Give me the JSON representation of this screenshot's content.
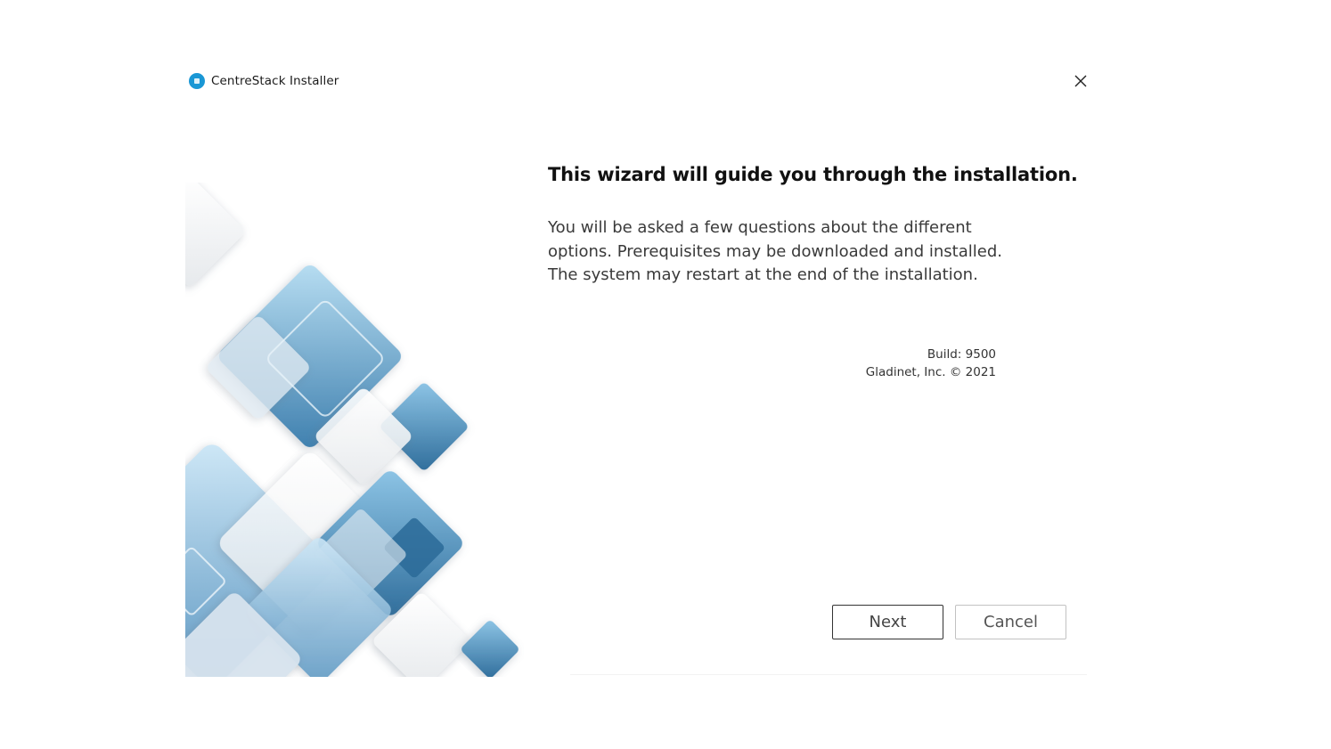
{
  "window": {
    "title": "CentreStack Installer",
    "app_icon": "centrestack-logo-icon",
    "close_icon": "close-icon",
    "accent_color": "#1a97d5"
  },
  "content": {
    "heading": "This wizard will guide you through the installation.",
    "description_lines": [
      "You will be asked a few questions about the different",
      "options. Prerequisites may be downloaded and installed.",
      "The system may restart at the end of the installation."
    ],
    "build": "Build: 9500",
    "copyright": "Gladinet, Inc. © 2021"
  },
  "buttons": {
    "next_label": "Next",
    "cancel_label": "Cancel"
  },
  "colors": {
    "diamond_blue_light": "#a9d3ec",
    "diamond_blue_mid": "#6fa9cd",
    "diamond_blue_dark": "#3b7aa8",
    "diamond_white": "#f4f6f8"
  }
}
